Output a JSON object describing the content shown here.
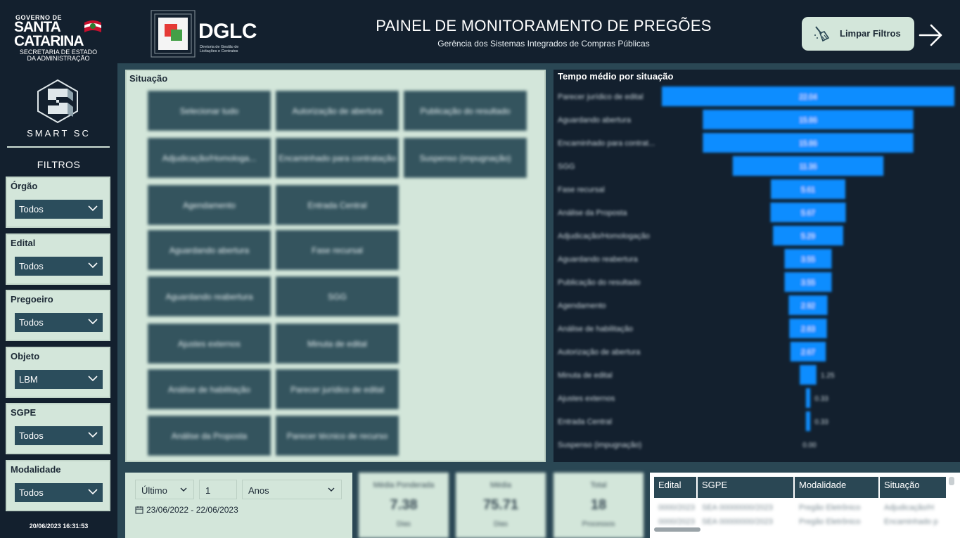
{
  "sidebar": {
    "gov_logo": {
      "line1": "GOVERNO DE",
      "line2": "SANTA",
      "line3": "CATARINA",
      "line4": "SECRETARIA DE ESTADO DA ADMINISTRAÇÃO"
    },
    "smart_label": "SMART SC",
    "filters_title": "FILTROS",
    "filters": [
      {
        "label": "Órgão",
        "value": "Todos"
      },
      {
        "label": "Edital",
        "value": "Todos"
      },
      {
        "label": "Pregoeiro",
        "value": "Todos"
      },
      {
        "label": "Objeto",
        "value": "LBM"
      },
      {
        "label": "SGPE",
        "value": "Todos"
      },
      {
        "label": "Modalidade",
        "value": "Todos"
      }
    ],
    "timestamp": "20/06/2023 16:31:53"
  },
  "header": {
    "logo_text": "DGLC",
    "logo_subtext": "Diretoria de Gestão de Licitações e Contratos",
    "title": "PAINEL DE MONITORAMENTO DE PREGÕES",
    "subtitle": "Gerência dos Sistemas Integrados de Compras Públicas",
    "clear_filters_label": "Limpar Filtros"
  },
  "situacao": {
    "title": "Situação",
    "buttons": [
      "Selecionar tudo",
      "Autorização de abertura",
      "Publicação do resultado",
      "Adjudicação/Homologa...",
      "Encaminhado para contratação",
      "Suspenso (impugnação)",
      "Agendamento",
      "Entrada Central",
      "Aguardando abertura",
      "Fase recursal",
      "Aguardando reabertura",
      "SGG",
      "Ajustes externos",
      "Minuta de edital",
      "Análise de habilitação",
      "Parecer jurídico de edital",
      "Análise da Proposta",
      "Parecer técnico de recurso"
    ]
  },
  "funnel": {
    "title": "Tempo médio por situação"
  },
  "chart_data": {
    "type": "bar",
    "title": "Tempo médio por situação",
    "categories": [
      "Parecer jurídico de edital",
      "Aguardando abertura",
      "Encaminhado para contrat...",
      "SGG",
      "Fase recursal",
      "Análise da Proposta",
      "Adjudicação/Homologação",
      "Aguardando reabertura",
      "Publicação do resultado",
      "Agendamento",
      "Análise de habilitação",
      "Autorização de abertura",
      "Minuta de edital",
      "Ajustes externos",
      "Entrada Central",
      "Suspenso (impugnação)"
    ],
    "values": [
      22.04,
      15.86,
      15.86,
      11.36,
      5.61,
      5.67,
      5.29,
      3.55,
      3.55,
      2.92,
      2.83,
      2.67,
      1.25,
      0.33,
      0.33,
      0.0
    ],
    "value_labels": [
      "22.04",
      "15.86",
      "15.86",
      "11.36",
      "5.61",
      "5.67",
      "5.29",
      "3.55",
      "3.55",
      "2.92",
      "2.83",
      "2.67",
      "1.25",
      "0.33",
      "0.33",
      "0.00"
    ],
    "bar_color": "#118dff",
    "xlabel": "",
    "ylabel": ""
  },
  "date_filter": {
    "period": "Último",
    "count": "1",
    "unit": "Anos",
    "range": "23/06/2022 - 22/06/2023"
  },
  "kpis": [
    {
      "label": "Média Ponderada",
      "value": "7.38",
      "sub": "Dias"
    },
    {
      "label": "Média",
      "value": "75.71",
      "sub": "Dias"
    },
    {
      "label": "Total",
      "value": "18",
      "sub": "Processos"
    }
  ],
  "table": {
    "columns": [
      "Edital",
      "SGPE",
      "Modalidade",
      "Situação"
    ],
    "rows": [
      [
        "0000/2023",
        "SEA 00000000/2023",
        "Pregão Eletrônico",
        "Adjudicação/H"
      ],
      [
        "0000/2023",
        "SEA 00000000/2023",
        "Pregão Eletrônico",
        "Encaminhado p"
      ]
    ]
  },
  "colors": {
    "background": "#13202e",
    "panel": "#d3e6da",
    "accent": "#2a4754",
    "bar": "#118dff"
  }
}
